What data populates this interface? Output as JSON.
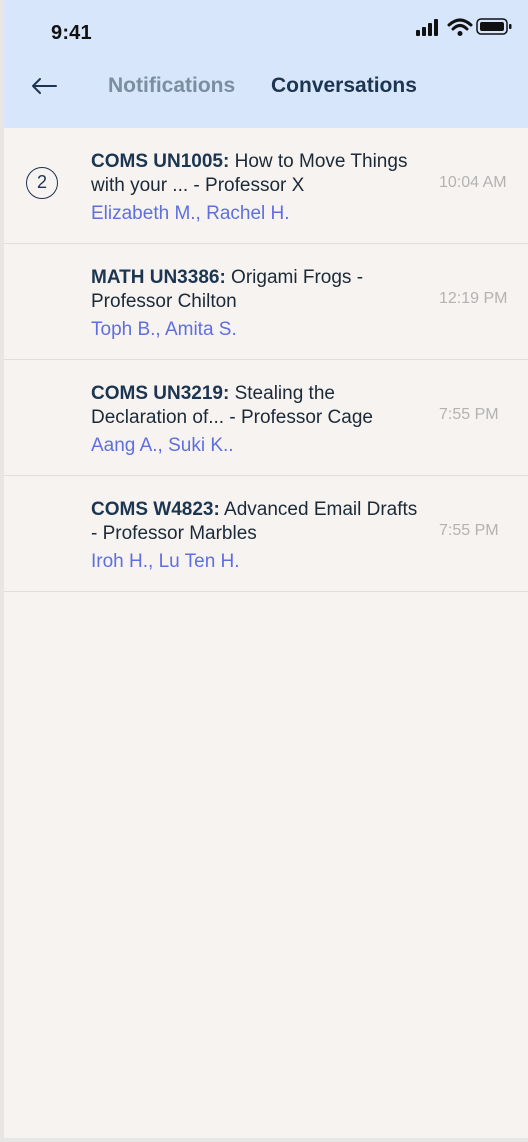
{
  "status_bar": {
    "time": "9:41"
  },
  "header": {
    "tabs": [
      {
        "label": "Notifications",
        "active": false
      },
      {
        "label": "Conversations",
        "active": true
      }
    ]
  },
  "conversations": [
    {
      "unread_count": "2",
      "course": "COMS UN1005:",
      "title": " How to Move Things with your ... - Professor X",
      "participants": "Elizabeth M., Rachel H.",
      "time": "10:04 AM"
    },
    {
      "unread_count": null,
      "course": "MATH UN3386:",
      "title": " Origami Frogs - Professor Chilton",
      "participants": "Toph B., Amita S.",
      "time": "12:19 PM"
    },
    {
      "unread_count": null,
      "course": "COMS UN3219:",
      "title": " Stealing the Declaration of... - Professor Cage",
      "participants": "Aang A., Suki K..",
      "time": "7:55 PM"
    },
    {
      "unread_count": null,
      "course": "COMS W4823:",
      "title": " Advanced Email Drafts - Professor Marbles",
      "participants": "Iroh H., Lu Ten H.",
      "time": "7:55 PM"
    }
  ],
  "colors": {
    "header_bg": "#d8e6fc",
    "page_bg": "#f6f3f1",
    "accent_navy": "#1c3550",
    "participant_blue": "#5f6fe0",
    "muted_tab": "#7b8ea0",
    "time_gray": "#b3b3b3"
  },
  "icons": {
    "back": "back-arrow-icon",
    "signal": "cellular-signal-icon",
    "wifi": "wifi-icon",
    "battery": "battery-icon"
  }
}
